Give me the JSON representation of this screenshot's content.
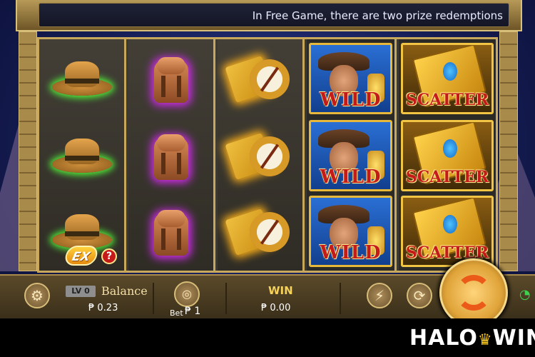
{
  "banner": {
    "message": "In Free Game, there are two prize redemptions"
  },
  "reels": [
    {
      "symbol": "hat",
      "cells": [
        "hat",
        "hat",
        "hat"
      ]
    },
    {
      "symbol": "backpack",
      "cells": [
        "backpack",
        "backpack",
        "backpack"
      ]
    },
    {
      "symbol": "compass",
      "cells": [
        "compass",
        "compass",
        "compass"
      ]
    },
    {
      "symbol": "wild",
      "label": "WILD"
    },
    {
      "symbol": "scatter",
      "label": "SCATTER"
    }
  ],
  "extra": {
    "ex_label": "EX",
    "help_label": "?"
  },
  "panel": {
    "level_label": "LV 0",
    "balance_label": "Balance",
    "balance_value": "₱ 0.23",
    "bet_label": "Bet",
    "bet_value": "₱ 1",
    "win_label": "WIN",
    "win_value": "₱ 0.00"
  },
  "brand": {
    "name_left": "HALO",
    "name_right": "WIN"
  },
  "colors": {
    "hat_glow": "#54ff3a",
    "backpack_glow": "#d52cf0",
    "compass_glow": "#ffb21a",
    "wild_red": "#c41a1a",
    "frame_gold": "#c7a85d"
  }
}
